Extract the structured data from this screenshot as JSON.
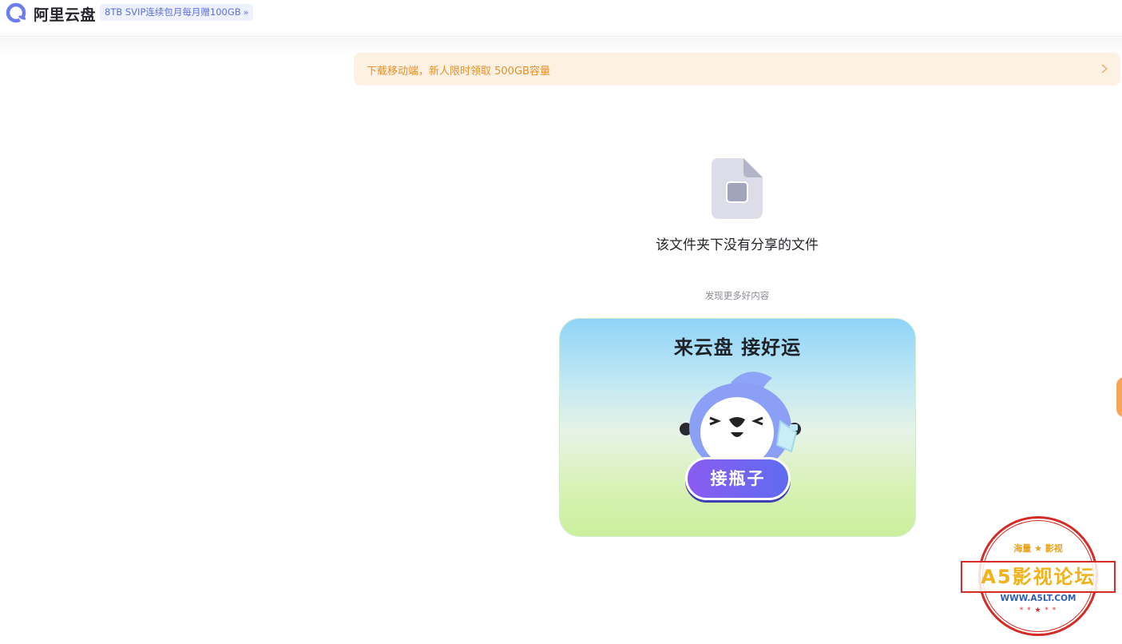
{
  "header": {
    "app_name": "阿里云盘",
    "promo_badge": "8TB SVIP连续包月每月赠100GB",
    "promo_badge_arrow": "»"
  },
  "notice": {
    "text": "下载移动端，新人限时领取 500GB容量"
  },
  "empty_state": {
    "title": "该文件夹下没有分享的文件",
    "discover_label": "发现更多好内容"
  },
  "banner": {
    "title": "来云盘 接好运",
    "button_label": "接瓶子"
  },
  "watermark": {
    "top_text": "海量 ★ 影视",
    "main_text": "A5影视论坛",
    "url": "WWW.A5LT.COM",
    "stars": "* * ★ * *"
  },
  "colors": {
    "brand_blue": "#5c6fe0",
    "notice_orange": "#e8902a",
    "notice_bg": "#fdf1e3",
    "button_purple": "#7a5cf0"
  }
}
